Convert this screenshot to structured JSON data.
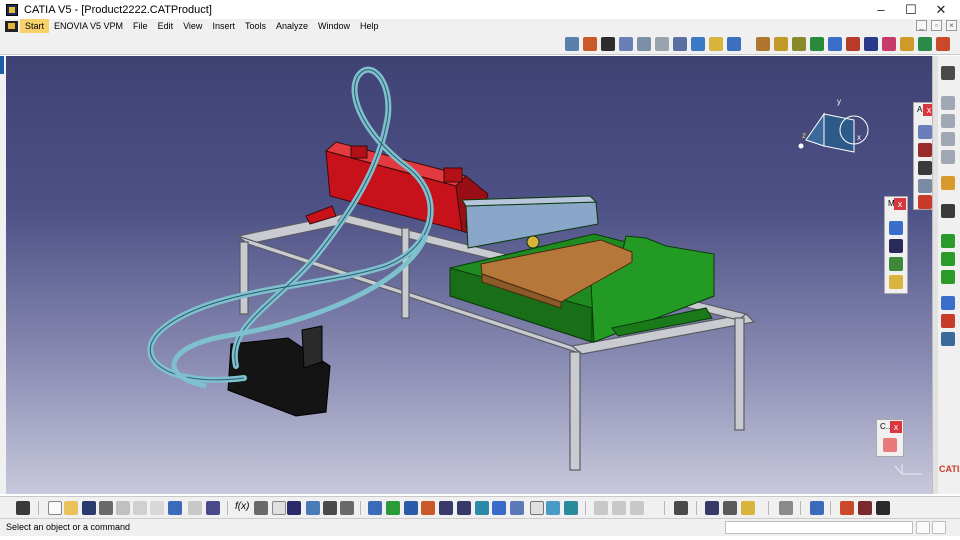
{
  "window": {
    "title": "CATIA V5 - [Product2222.CATProduct]",
    "minimize_glyph": "–",
    "maximize_glyph": "☐",
    "close_glyph": "✕"
  },
  "menu": {
    "items": [
      "Start",
      "ENOVIA V5 VPM",
      "File",
      "Edit",
      "View",
      "Insert",
      "Tools",
      "Analyze",
      "Window",
      "Help"
    ]
  },
  "floating_toolbars": {
    "top_right_label": "A",
    "middle_right_label": "M",
    "bottom_right_label": "C..."
  },
  "status": {
    "message": "Select an object or a command",
    "command_value": ""
  },
  "compass": {
    "x_label": "x",
    "y_label": "y",
    "z_label": "z"
  },
  "colors": {
    "viewport_top": "#3f4273",
    "viewport_bottom": "#c8c9dc",
    "cylinder": "#c8121b",
    "base_green": "#1f8a1f",
    "plate_tan": "#b5783a",
    "frame_grey": "#c9cbd0",
    "hose": "#7fc0cf"
  },
  "icons": {
    "top_toolbar": [
      "sketch-icon",
      "part-icon",
      "assembly-icon",
      "measure-icon",
      "pencil-icon",
      "grid-icon",
      "explode-icon",
      "sync-icon",
      "network-icon",
      "bolt-icon",
      "constraint-icon",
      "gear-icon",
      "export-icon",
      "snap-icon",
      "flag-icon",
      "catalog-icon",
      "manipulate-icon",
      "palette-icon",
      "settings-icon"
    ],
    "bottom_toolbar": [
      "camera-icon",
      "new-icon",
      "open-icon",
      "save-icon",
      "print-icon",
      "cut-icon",
      "copy-icon",
      "paste-icon",
      "undo-icon",
      "redo-icon",
      "help-icon",
      "formula-icon",
      "comment-icon",
      "table-icon",
      "hierarchy-icon",
      "knowledge-icon",
      "macro-icon",
      "fly-icon",
      "fit-all-icon",
      "pan-icon",
      "rotate-icon",
      "zoom-in-icon",
      "zoom-out-icon",
      "normal-view-icon",
      "multi-view-icon",
      "iso-view-icon",
      "render-style-icon",
      "hide-show-icon",
      "swap-icon",
      "render-icon",
      "scene-icon",
      "cloud-icon",
      "material-icon",
      "compute-icon",
      "catia-logo"
    ]
  }
}
